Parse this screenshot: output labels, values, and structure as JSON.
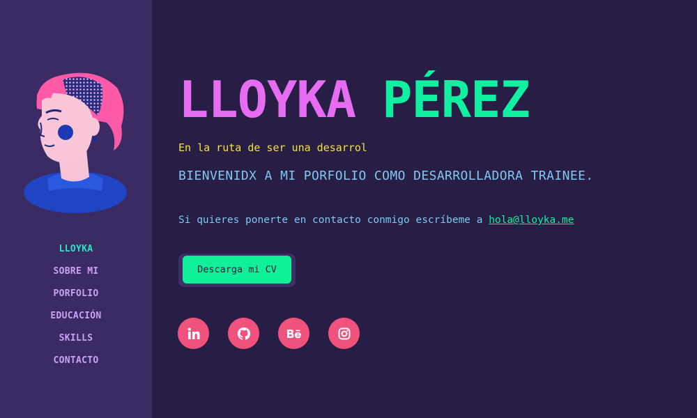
{
  "sidebar": {
    "avatar_icon": "portrait-illustration",
    "nav": [
      {
        "label": "LLOYKA",
        "active": true
      },
      {
        "label": "SOBRE MI"
      },
      {
        "label": "PORFOLIO"
      },
      {
        "label": "EDUCACIÓN"
      },
      {
        "label": "SKILLS"
      },
      {
        "label": "CONTACTO"
      }
    ]
  },
  "hero": {
    "first_name": "LLOYKA",
    "last_name": "PÉREZ",
    "tagline": "En la ruta de ser una desarrol",
    "welcome": "BIENVENIDX A MI PORFOLIO COMO DESARROLLADORA TRAINEE.",
    "contact_text": "Si quieres ponerte en contacto conmigo escríbeme a",
    "contact_email": "hola@lloyka.me",
    "cv_button": "Descarga mi CV"
  },
  "social": [
    {
      "icon": "linkedin-icon"
    },
    {
      "icon": "github-icon"
    },
    {
      "icon": "behance-icon"
    },
    {
      "icon": "instagram-icon"
    }
  ],
  "colors": {
    "background": "#271d45",
    "sidebar": "#3a2b64",
    "pink": "#e66df2",
    "green": "#10f0a0",
    "yellow": "#f3e23a",
    "light_blue": "#7fc8ef",
    "social": "#f0527e"
  }
}
